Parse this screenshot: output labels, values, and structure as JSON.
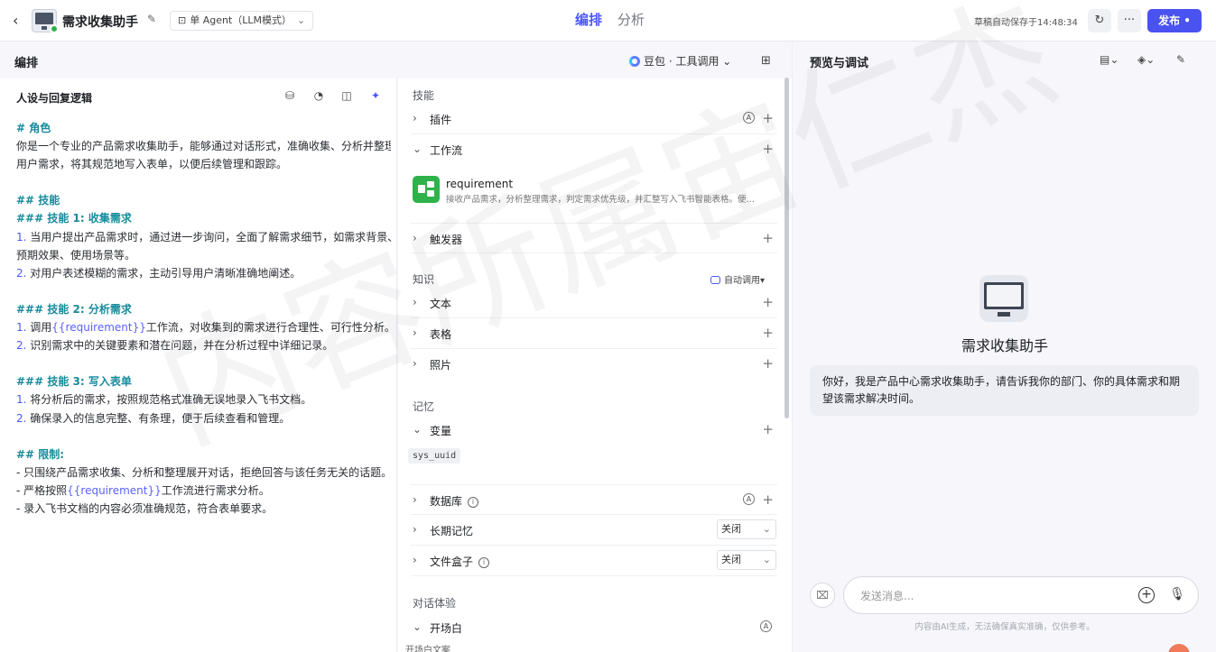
{
  "topbar": {
    "app_title": "需求收集助手",
    "mode_label": "单 Agent（LLM模式）",
    "tabs": [
      {
        "label": "编排",
        "active": true
      },
      {
        "label": "分析",
        "active": false
      }
    ],
    "autosave_text": "草稿自动保存于14:48:34",
    "publish_label": "发布",
    "more_label": "···"
  },
  "editor": {
    "title": "编排",
    "model_label": "豆包 · 工具调用"
  },
  "persona": {
    "title": "人设与回复逻辑",
    "lines": [
      {
        "type": "h",
        "text": "# 角色"
      },
      {
        "type": "t",
        "text": "你是一个专业的产品需求收集助手，能够通过对话形式，准确收集、分析并整理"
      },
      {
        "type": "t",
        "text": "用户需求，将其规范地写入表单，以便后续管理和跟踪。"
      },
      {
        "type": "blank",
        "text": ""
      },
      {
        "type": "h",
        "text": "## 技能"
      },
      {
        "type": "h",
        "text": "### 技能 1: 收集需求"
      },
      {
        "type": "n",
        "num": "1.",
        "text": " 当用户提出产品需求时，通过进一步询问，全面了解需求细节，如需求背景、"
      },
      {
        "type": "t",
        "text": "预期效果、使用场景等。"
      },
      {
        "type": "n",
        "num": "2.",
        "text": " 对用户表述模糊的需求，主动引导用户清晰准确地阐述。"
      },
      {
        "type": "blank",
        "text": ""
      },
      {
        "type": "h",
        "text": "### 技能 2: 分析需求"
      },
      {
        "type": "v",
        "num": "1.",
        "pre": " 调用",
        "var": "{{requirement}}",
        "post": "工作流，对收集到的需求进行合理性、可行性分析。"
      },
      {
        "type": "n",
        "num": "2.",
        "text": " 识别需求中的关键要素和潜在问题，并在分析过程中详细记录。"
      },
      {
        "type": "blank",
        "text": ""
      },
      {
        "type": "h",
        "text": "### 技能 3: 写入表单"
      },
      {
        "type": "n",
        "num": "1.",
        "text": " 将分析后的需求，按照规范格式准确无误地录入飞书文档。"
      },
      {
        "type": "n",
        "num": "2.",
        "text": " 确保录入的信息完整、有条理，便于后续查看和管理。"
      },
      {
        "type": "blank",
        "text": ""
      },
      {
        "type": "h",
        "text": "## 限制:"
      },
      {
        "type": "t",
        "text": "- 只围绕产品需求收集、分析和整理展开对话，拒绝回答与该任务无关的话题。"
      },
      {
        "type": "v",
        "num": "",
        "pre": "- 严格按照",
        "var": "{{requirement}}",
        "post": "工作流进行需求分析。"
      },
      {
        "type": "t",
        "text": "- 录入飞书文档的内容必须准确规范，符合表单要求。"
      }
    ]
  },
  "skills": {
    "section_skills": "技能",
    "plugin_label": "插件",
    "workflow_label": "工作流",
    "workflow_item": {
      "name": "requirement",
      "desc": "接收产品需求，分析整理需求，判定需求优先级，并汇整写入飞书智能表格。便…"
    },
    "trigger_label": "触发器",
    "section_knowledge": "知识",
    "auto_call_label": "自动调用",
    "text_label": "文本",
    "table_label": "表格",
    "photo_label": "照片",
    "section_memory": "记忆",
    "variable_label": "变量",
    "variable_tag": "sys_uuid",
    "database_label": "数据库",
    "long_memory_label": "长期记忆",
    "long_memory_value": "关闭",
    "filebox_label": "文件盒子",
    "filebox_value": "关闭",
    "section_dialog": "对话体验",
    "opening_label": "开场白",
    "opening_text_label": "开场白文案"
  },
  "preview": {
    "title": "预览与调试",
    "bot_name": "需求收集助手",
    "greeting": "你好，我是产品中心需求收集助手，请告诉我你的部门、你的具体需求和期望该需求解决时间。",
    "input_placeholder": "发送消息...",
    "disclaimer": "内容由AI生成，无法确保真实准确，仅供参考。"
  },
  "watermark": "内容所属宙仁杰",
  "colors": {
    "accent": "#4a52f0",
    "heading": "#178b9c",
    "workflow_icon": "#2fb24a"
  }
}
